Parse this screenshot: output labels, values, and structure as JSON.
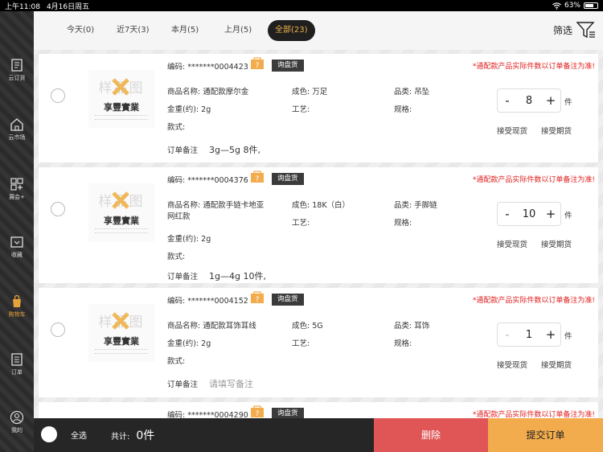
{
  "status_bar": {
    "time": "上午11:08",
    "date": "4月16日周五",
    "battery": "63%"
  },
  "sidebar": [
    {
      "label": "云订货",
      "icon": "cloud-order-icon"
    },
    {
      "label": "云市场",
      "icon": "market-icon"
    },
    {
      "label": "展会+",
      "icon": "exhibition-icon"
    },
    {
      "label": "收藏",
      "icon": "favorite-icon"
    },
    {
      "label": "购物车",
      "icon": "cart-icon",
      "active": true
    },
    {
      "label": "订单",
      "icon": "order-icon"
    },
    {
      "label": "我的",
      "icon": "profile-icon"
    }
  ],
  "tabs": [
    {
      "label": "今天(0)"
    },
    {
      "label": "近7天(3)"
    },
    {
      "label": "本月(5)"
    },
    {
      "label": "上月(5)"
    },
    {
      "label": "全部(23)",
      "active": true
    }
  ],
  "filter_label": "筛选",
  "common": {
    "code_label": "编码:",
    "inquiry_label": "询盘货",
    "notice": "*通配款产品实际件数以订单备注为准!",
    "name_label": "商品名称:",
    "fineness_label": "成色:",
    "category_label": "品类:",
    "weight_label": "金重(约):",
    "craft_label": "工艺:",
    "spec_label": "规格:",
    "style_label": "款式:",
    "remark_label": "订单备注",
    "unit": "件",
    "accept_spot": "接受现货",
    "accept_future": "接受期货",
    "thumb_watermark": "样品图",
    "thumb_brand": "享豐實業"
  },
  "items": [
    {
      "code": "*******0004423",
      "name": "通配款摩尔金",
      "fineness": "万足",
      "category": "吊坠",
      "weight": "2g",
      "remark": "3g—5g 8件,",
      "qty": "8"
    },
    {
      "code": "*******0004376",
      "name": "通配款手链卡地亚",
      "name2": "网红款",
      "fineness": "18K（白）",
      "category": "手脚链",
      "weight": "2g",
      "remark": "1g—4g 10件,",
      "qty": "10"
    },
    {
      "code": "*******0004152",
      "name": "通配款耳饰耳线",
      "fineness": "5G",
      "category": "耳饰",
      "weight": "2g",
      "remark": "请填写备注",
      "remark_placeholder": true,
      "qty": "1"
    },
    {
      "code": "*******0004290"
    }
  ],
  "bottom": {
    "select_all": "全选",
    "total_label": "共计:",
    "total_value": "0件",
    "delete": "删除",
    "submit": "提交订单"
  },
  "colors": {
    "accent": "#f0b34a",
    "delete": "#e05656",
    "submit": "#f2ac4d",
    "notice": "#e02020"
  }
}
